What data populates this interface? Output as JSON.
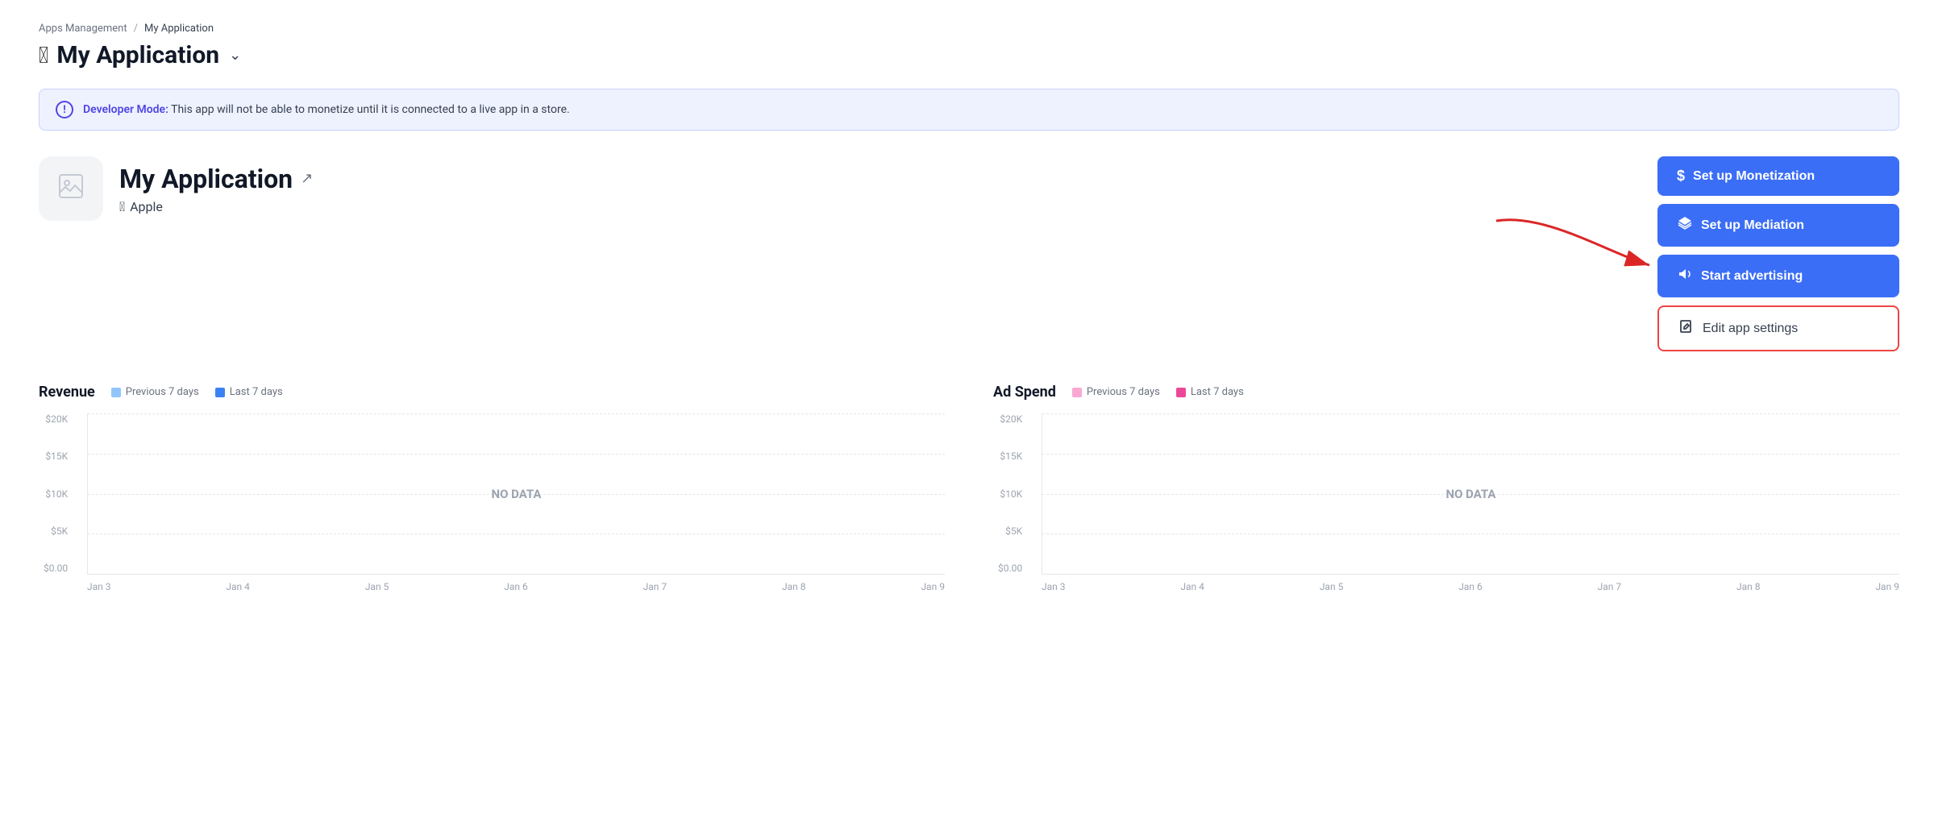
{
  "breadcrumb": {
    "parent": "Apps Management",
    "separator": "/",
    "current": "My Application"
  },
  "page_title": "My Application",
  "banner": {
    "label": "Developer Mode:",
    "message": " This app will not be able to monetize until it is connected to a live app in a store."
  },
  "app": {
    "name": "My Application",
    "platform": "Apple"
  },
  "buttons": {
    "monetization": "Set up Monetization",
    "mediation": "Set up Mediation",
    "advertising": "Start advertising",
    "edit_settings": "Edit app settings"
  },
  "revenue_chart": {
    "title": "Revenue",
    "legend_prev": "Previous 7 days",
    "legend_last": "Last 7 days",
    "prev_color": "#93c5fd",
    "last_color": "#3b82f6",
    "no_data": "NO DATA",
    "y_labels": [
      "$20K",
      "$15K",
      "$10K",
      "$5K",
      "$0.00"
    ],
    "x_labels": [
      "Jan 3",
      "Jan 4",
      "Jan 5",
      "Jan 6",
      "Jan 7",
      "Jan 8",
      "Jan 9"
    ]
  },
  "ad_spend_chart": {
    "title": "Ad Spend",
    "legend_prev": "Previous 7 days",
    "legend_last": "Last 7 days",
    "prev_color": "#f9a8d4",
    "last_color": "#ec4899",
    "no_data": "NO DATA",
    "y_labels": [
      "$20K",
      "$15K",
      "$10K",
      "$5K",
      "$0.00"
    ],
    "x_labels": [
      "Jan 3",
      "Jan 4",
      "Jan 5",
      "Jan 6",
      "Jan 7",
      "Jan 8",
      "Jan 9"
    ]
  }
}
